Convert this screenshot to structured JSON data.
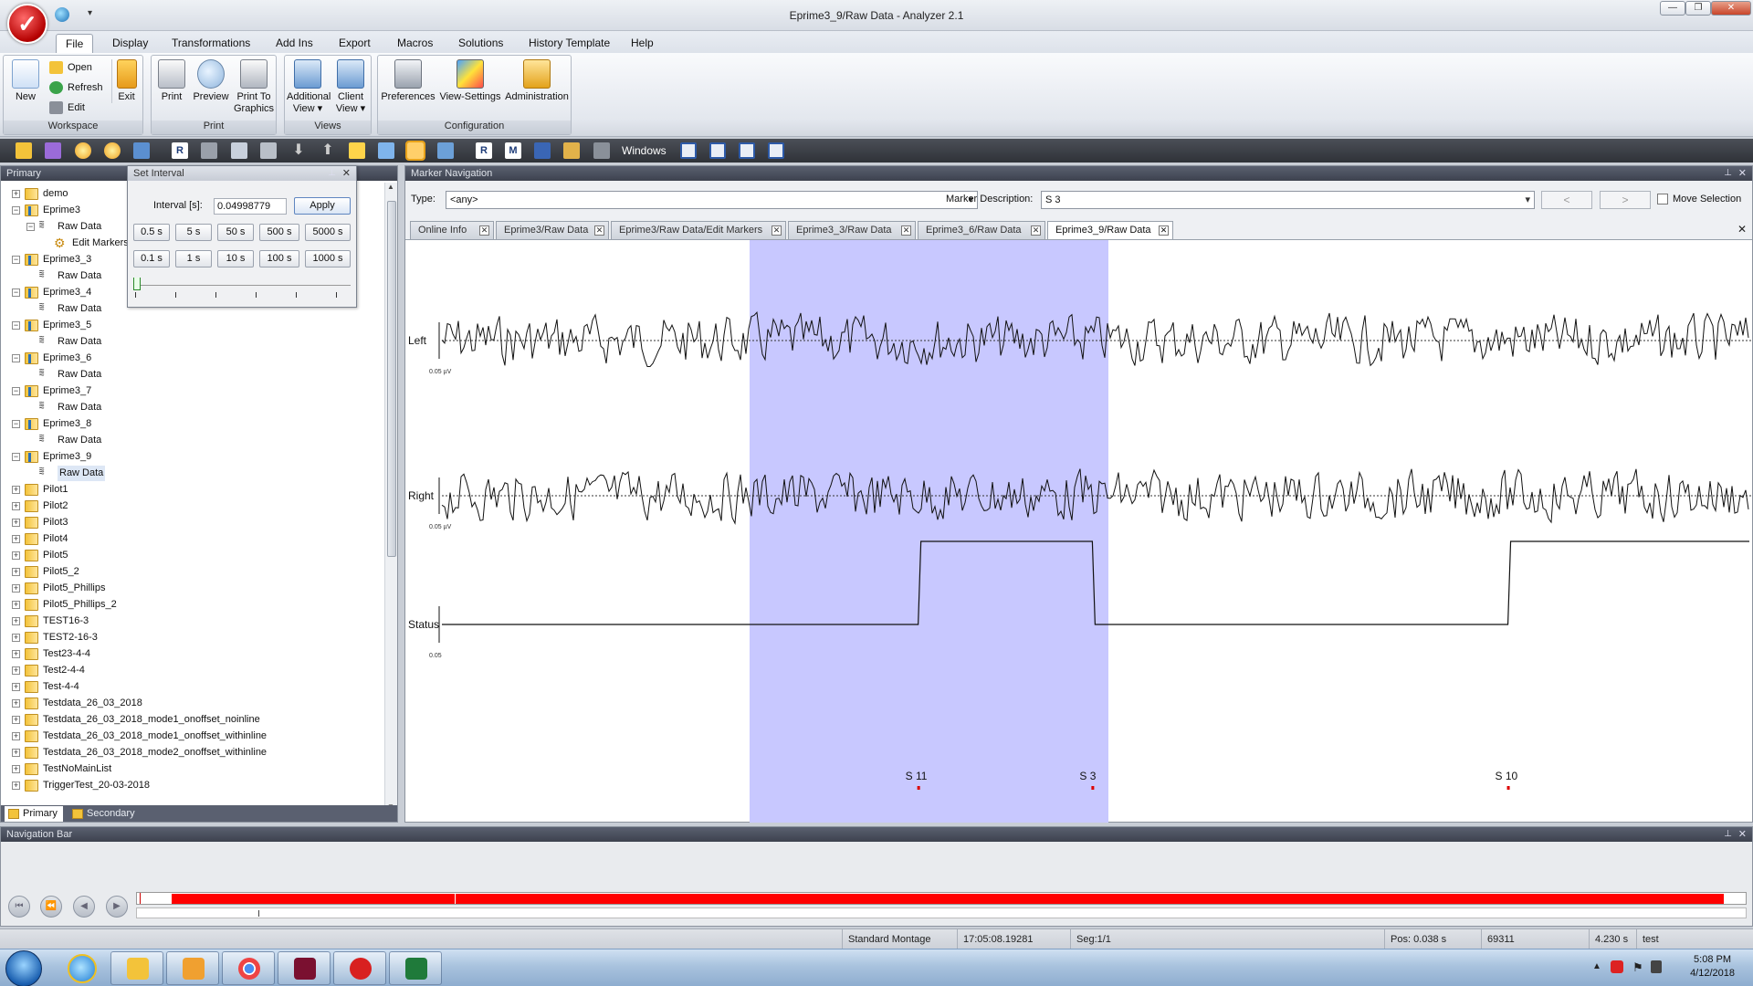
{
  "window": {
    "title": "Eprime3_9/Raw Data - Analyzer 2.1"
  },
  "menu": [
    "File",
    "Display",
    "Transformations",
    "Add Ins",
    "Export",
    "Macros",
    "Solutions",
    "History Template",
    "Help"
  ],
  "ribbon": {
    "workspace": {
      "label": "Workspace",
      "new": "New",
      "open": "Open",
      "refresh": "Refresh",
      "edit": "Edit",
      "exit": "Exit"
    },
    "print": {
      "label": "Print",
      "print": "Print",
      "preview": "Preview",
      "print_to_graphics": "Print To Graphics"
    },
    "views": {
      "label": "Views",
      "additional": "Additional View ▾",
      "client": "Client View ▾"
    },
    "configuration": {
      "label": "Configuration",
      "preferences": "Preferences",
      "view_settings": "View-Settings",
      "administration": "Administration"
    }
  },
  "toolbar": {
    "windows": "Windows"
  },
  "primary": {
    "title": "Primary",
    "tree": [
      {
        "label": "demo",
        "level": 0,
        "type": "folder",
        "expander": "+"
      },
      {
        "label": "Eprime3",
        "level": 0,
        "type": "folder-open",
        "expander": "−"
      },
      {
        "label": "Raw Data",
        "level": 1,
        "type": "raw",
        "expander": "−"
      },
      {
        "label": "Edit Markers",
        "level": 2,
        "type": "gear",
        "expander": ""
      },
      {
        "label": "Eprime3_3",
        "level": 0,
        "type": "folder-open",
        "expander": "−"
      },
      {
        "label": "Raw Data",
        "level": 1,
        "type": "raw",
        "expander": ""
      },
      {
        "label": "Eprime3_4",
        "level": 0,
        "type": "folder-open",
        "expander": "−"
      },
      {
        "label": "Raw Data",
        "level": 1,
        "type": "raw",
        "expander": ""
      },
      {
        "label": "Eprime3_5",
        "level": 0,
        "type": "folder-open",
        "expander": "−"
      },
      {
        "label": "Raw Data",
        "level": 1,
        "type": "raw",
        "expander": ""
      },
      {
        "label": "Eprime3_6",
        "level": 0,
        "type": "folder-open",
        "expander": "−"
      },
      {
        "label": "Raw Data",
        "level": 1,
        "type": "raw",
        "expander": ""
      },
      {
        "label": "Eprime3_7",
        "level": 0,
        "type": "folder-open",
        "expander": "−"
      },
      {
        "label": "Raw Data",
        "level": 1,
        "type": "raw",
        "expander": ""
      },
      {
        "label": "Eprime3_8",
        "level": 0,
        "type": "folder-open",
        "expander": "−"
      },
      {
        "label": "Raw Data",
        "level": 1,
        "type": "raw",
        "expander": ""
      },
      {
        "label": "Eprime3_9",
        "level": 0,
        "type": "folder-open",
        "expander": "−"
      },
      {
        "label": "Raw Data",
        "level": 1,
        "type": "raw",
        "expander": "",
        "selected": true
      },
      {
        "label": "Pilot1",
        "level": 0,
        "type": "folder",
        "expander": "+"
      },
      {
        "label": "Pilot2",
        "level": 0,
        "type": "folder",
        "expander": "+"
      },
      {
        "label": "Pilot3",
        "level": 0,
        "type": "folder",
        "expander": "+"
      },
      {
        "label": "Pilot4",
        "level": 0,
        "type": "folder",
        "expander": "+"
      },
      {
        "label": "Pilot5",
        "level": 0,
        "type": "folder",
        "expander": "+"
      },
      {
        "label": "Pilot5_2",
        "level": 0,
        "type": "folder",
        "expander": "+"
      },
      {
        "label": "Pilot5_Phillips",
        "level": 0,
        "type": "folder",
        "expander": "+"
      },
      {
        "label": "Pilot5_Phillips_2",
        "level": 0,
        "type": "folder",
        "expander": "+"
      },
      {
        "label": "TEST16-3",
        "level": 0,
        "type": "folder",
        "expander": "+"
      },
      {
        "label": "TEST2-16-3",
        "level": 0,
        "type": "folder",
        "expander": "+"
      },
      {
        "label": "Test23-4-4",
        "level": 0,
        "type": "folder",
        "expander": "+"
      },
      {
        "label": "Test2-4-4",
        "level": 0,
        "type": "folder",
        "expander": "+"
      },
      {
        "label": "Test-4-4",
        "level": 0,
        "type": "folder",
        "expander": "+"
      },
      {
        "label": "Testdata_26_03_2018",
        "level": 0,
        "type": "folder",
        "expander": "+"
      },
      {
        "label": "Testdata_26_03_2018_mode1_onoffset_noinline",
        "level": 0,
        "type": "folder",
        "expander": "+"
      },
      {
        "label": "Testdata_26_03_2018_mode1_onoffset_withinline",
        "level": 0,
        "type": "folder",
        "expander": "+"
      },
      {
        "label": "Testdata_26_03_2018_mode2_onoffset_withinline",
        "level": 0,
        "type": "folder",
        "expander": "+"
      },
      {
        "label": "TestNoMainList",
        "level": 0,
        "type": "folder",
        "expander": "+"
      },
      {
        "label": "TriggerTest_20-03-2018",
        "level": 0,
        "type": "folder",
        "expander": "+"
      }
    ],
    "tabs": [
      "Primary",
      "Secondary"
    ]
  },
  "set_interval": {
    "title": "Set Interval",
    "label": "Interval [s]:",
    "value": "0.04998779",
    "apply": "Apply",
    "row1": [
      "0.5 s",
      "5 s",
      "50 s",
      "500 s",
      "5000 s"
    ],
    "row2": [
      "0.1 s",
      "1 s",
      "10 s",
      "100 s",
      "1000 s"
    ]
  },
  "marker_nav": {
    "title": "Marker Navigation",
    "type_label": "Type:",
    "type_value": "<any>",
    "desc_label": "Marker Description:",
    "desc_value": "S  3",
    "prev": "<",
    "next": ">",
    "move_selection": "Move Selection",
    "tabs": [
      "Online Info",
      "Eprime3/Raw Data",
      "Eprime3/Raw Data/Edit Markers",
      "Eprime3_3/Raw Data",
      "Eprime3_6/Raw Data",
      "Eprime3_9/Raw Data"
    ],
    "active_tab": 5
  },
  "plot": {
    "channels": [
      {
        "name": "Left",
        "scale": "0.05 µV"
      },
      {
        "name": "Right",
        "scale": "0.05 µV"
      },
      {
        "name": "Status",
        "scale": "0.05"
      }
    ],
    "selection_color": "#c8c8ff",
    "markers": [
      {
        "label": "S 11",
        "t": 0.361
      },
      {
        "label": "S  3",
        "t": 0.493
      },
      {
        "label": "S 10",
        "t": 0.808
      }
    ],
    "status_steps": [
      {
        "t": 0.0,
        "high": false
      },
      {
        "t": 0.361,
        "high": true
      },
      {
        "t": 0.493,
        "high": false
      },
      {
        "t": 0.808,
        "high": true
      }
    ]
  },
  "navbar": {
    "title": "Navigation Bar",
    "bar_color": "#ff0000"
  },
  "statusbar": [
    "Standard Montage",
    "17:05:08.19281",
    "Seg:1/1",
    "Pos:  0.038 s",
    "69311",
    "4.230 s",
    "test"
  ],
  "taskbar": {
    "time": "5:08 PM",
    "date": "4/12/2018"
  }
}
